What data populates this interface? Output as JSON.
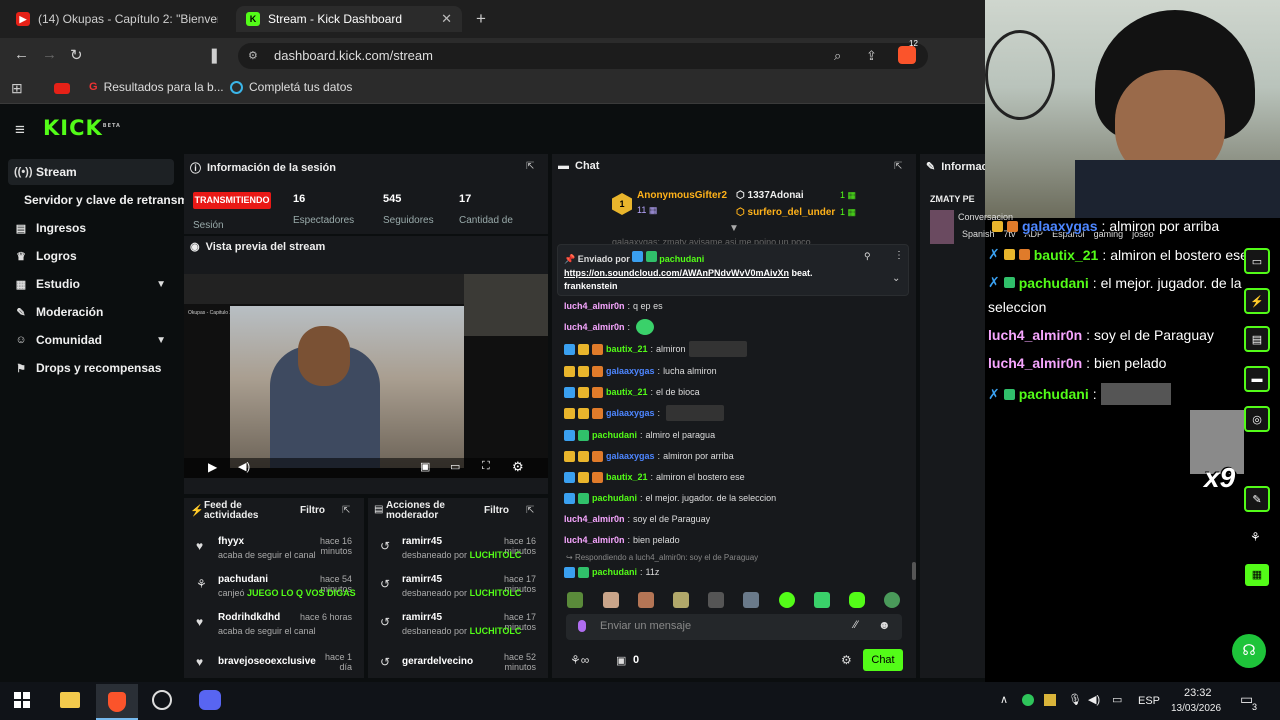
{
  "browser": {
    "tabs": [
      {
        "title": "(14) Okupas - Capítulo 2: \"Bienvenid",
        "active": false
      },
      {
        "title": "Stream - Kick Dashboard",
        "active": true
      }
    ],
    "url": "dashboard.kick.com/stream",
    "bookmarks": [
      "Resultados para la b...",
      "Completá tus datos"
    ],
    "extension_badge": "12"
  },
  "app": {
    "logo": "KICK",
    "logo_tag": "BETA",
    "nav": [
      {
        "label": "Stream",
        "icon": "broadcast-icon",
        "active": true
      },
      {
        "label": "Servidor y clave de retransm",
        "icon": "",
        "active": false
      },
      {
        "label": "Ingresos",
        "icon": "chart-icon",
        "active": false
      },
      {
        "label": "Logros",
        "icon": "trophy-icon",
        "active": false
      },
      {
        "label": "Estudio",
        "icon": "grid-icon",
        "active": false,
        "chevron": true
      },
      {
        "label": "Moderación",
        "icon": "wrench-icon",
        "active": false
      },
      {
        "label": "Comunidad",
        "icon": "people-icon",
        "active": false,
        "chevron": true
      },
      {
        "label": "Drops y recompensas",
        "icon": "gift-icon",
        "active": false
      }
    ]
  },
  "session": {
    "title": "Información de la sesión",
    "status": "TRANSMITIENDO",
    "status_label": "Sesión",
    "stats": [
      {
        "value": "16",
        "label": "Espectadores"
      },
      {
        "value": "545",
        "label": "Seguidores"
      },
      {
        "value": "17",
        "label": "Cantidad de"
      }
    ],
    "preview_title": "Vista previa del stream",
    "preview_caption": "Okupas - Capitulo 2"
  },
  "feed": {
    "title_line1": "Feed de",
    "title_line2": "actividades",
    "filter": "Filtro",
    "items": [
      {
        "name": "fhyyx",
        "time": "hace 16 minutos",
        "sub": "acaba de seguir el canal",
        "highlight": ""
      },
      {
        "name": "pachudani",
        "time": "hace 54 minutos",
        "sub": "canjeó",
        "highlight": "JUEGO LO Q VOS DIGAS"
      },
      {
        "name": "Rodrihdkdhd",
        "time": "hace 6 horas",
        "sub": "acaba de seguir el canal",
        "highlight": ""
      },
      {
        "name": "bravejoseoexclusive",
        "time": "hace 1 día",
        "sub": "",
        "highlight": ""
      }
    ]
  },
  "modactions": {
    "title_line1": "Acciones de",
    "title_line2": "moderador",
    "filter": "Filtro",
    "items": [
      {
        "name": "ramirr45",
        "time": "hace 16 minutos",
        "sub": "desbaneado por",
        "by": "LUCHITOLC"
      },
      {
        "name": "ramirr45",
        "time": "hace 17 minutos",
        "sub": "desbaneado por",
        "by": "LUCHITOLC"
      },
      {
        "name": "ramirr45",
        "time": "hace 17 minutos",
        "sub": "desbaneado por",
        "by": "LUCHITOLC"
      },
      {
        "name": "gerardelvecino",
        "time": "hace 52 minutos",
        "sub": "",
        "by": ""
      }
    ]
  },
  "chat": {
    "title": "Chat",
    "gifters": [
      {
        "name": "AnonymousGifter2",
        "count": "1"
      },
      {
        "name": "1337Adonai",
        "count": "1"
      },
      {
        "name": "surfero_del_under",
        "count": "1"
      }
    ],
    "gift_rank": "1",
    "gift_sub": "11",
    "pinned_by": "Enviado por",
    "pinned_user": "pachudani",
    "pinned_text": "https://on.soundcloud.com/AWAnPNdvWvV0mAivXn",
    "pinned_suffix": " beat. frankenstein",
    "clipped_line": "galaaxygas: zmaty avisame asi me pojno un poco",
    "messages": [
      {
        "user": "luch4_almir0n",
        "text": "q ep es",
        "color": "pink",
        "badges": []
      },
      {
        "user": "luch4_almir0n",
        "text": "",
        "color": "pink",
        "badges": [],
        "emote": true
      },
      {
        "user": "bautix_21",
        "text": "almiron",
        "color": "green",
        "badges": [
          "blue",
          "gold",
          "orange"
        ],
        "emote": true
      },
      {
        "user": "galaaxygas",
        "text": "lucha almiron",
        "color": "blue",
        "badges": [
          "gold",
          "gold",
          "orange"
        ]
      },
      {
        "user": "bautix_21",
        "text": "el de bioca",
        "color": "green",
        "badges": [
          "blue",
          "gold",
          "orange"
        ]
      },
      {
        "user": "galaaxygas",
        "text": "",
        "color": "blue",
        "badges": [
          "gold",
          "gold",
          "orange"
        ],
        "emote": true
      },
      {
        "user": "pachudani",
        "text": "almiro el paragua",
        "color": "green",
        "badges": [
          "blue",
          "green"
        ]
      },
      {
        "user": "galaaxygas",
        "text": "almiron por arriba",
        "color": "blue",
        "badges": [
          "gold",
          "gold",
          "orange"
        ]
      },
      {
        "user": "bautix_21",
        "text": "almiron el bostero ese",
        "color": "green",
        "badges": [
          "blue",
          "gold",
          "orange"
        ]
      },
      {
        "user": "pachudani",
        "text": "el mejor. jugador. de la seleccion",
        "color": "green",
        "badges": [
          "blue",
          "green"
        ]
      },
      {
        "user": "luch4_almir0n",
        "text": "soy el de Paraguay",
        "color": "pink",
        "badges": []
      },
      {
        "user": "luch4_almir0n",
        "text": "bien pelado",
        "color": "pink",
        "badges": []
      }
    ],
    "reply_to": "Respondiendo a luch4_almir0n: soy el de Paraguay",
    "last": {
      "user": "pachudani",
      "text": "11z"
    },
    "input_placeholder": "Enviar un mensaje",
    "points": "0",
    "send": "Chat"
  },
  "info_panel": {
    "title": "Informac",
    "channel": "ZMATY PE",
    "convo": "Conversacion",
    "tags": [
      "Spanish",
      "7tv",
      "ADP",
      "Español",
      "gaming",
      "joseo"
    ]
  },
  "overlay": {
    "lines": [
      {
        "user": "galaaxygas",
        "text": "almiron por arriba",
        "color": "blue"
      },
      {
        "user": "bautix_21",
        "text": "almiron el bostero ese",
        "color": "green"
      },
      {
        "user": "pachudani",
        "text": "el mejor. jugador. de la",
        "color": "green",
        "cont": "seleccion"
      },
      {
        "user": "luch4_almir0n",
        "text": "soy el de Paraguay",
        "color": "pink"
      },
      {
        "user": "luch4_almir0n",
        "text": "bien pelado",
        "color": "pink"
      },
      {
        "user": "pachudani",
        "text": "",
        "color": "green",
        "emote": true
      }
    ],
    "combo": "x9"
  },
  "taskbar": {
    "lang": "ESP",
    "time": "23:32",
    "date": "13/03/2026",
    "notif": "3"
  },
  "colors": {
    "accent": "#53fc18",
    "live": "#e91916"
  }
}
